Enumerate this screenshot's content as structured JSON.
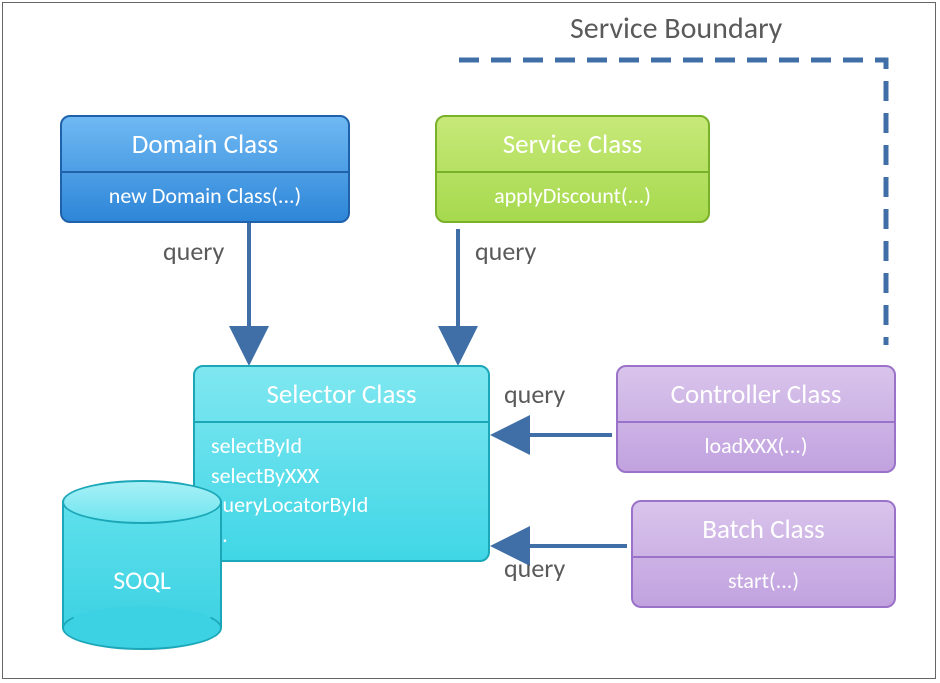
{
  "boundary_label": "Service Boundary",
  "edge_label": "query",
  "domain": {
    "title": "Domain Class",
    "body": "new Domain Class(...)"
  },
  "service": {
    "title": "Service Class",
    "body": "applyDiscount(...)"
  },
  "selector": {
    "title": "Selector Class",
    "lines": [
      "selectById",
      "selectByXXX",
      "queryLocatorById",
      "..."
    ]
  },
  "controller": {
    "title": "Controller Class",
    "body": "loadXXX(...)"
  },
  "batch": {
    "title": "Batch Class",
    "body": "start(...)"
  },
  "cylinder": "SOQL",
  "colors": {
    "arrow": "#3f6fa6",
    "boundary": "#3f6fa6"
  }
}
